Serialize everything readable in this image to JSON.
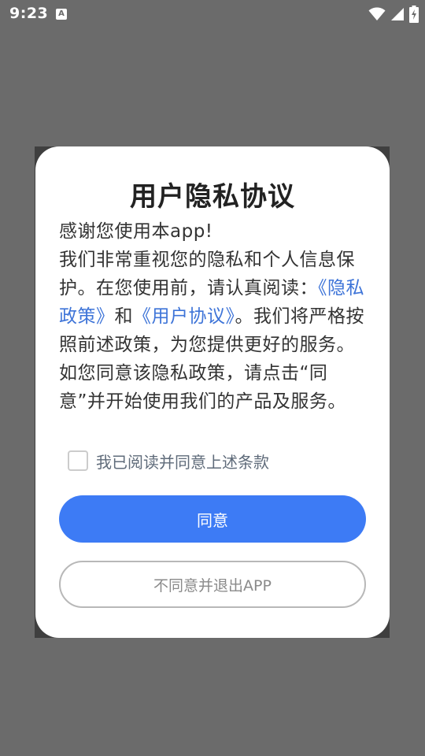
{
  "status_bar": {
    "time": "9:23",
    "notification_icon_letter": "A"
  },
  "dialog": {
    "title": "用户隐私协议",
    "body": {
      "line_intro": "感谢您使用本app!",
      "text_1": "我们非常重视您的隐私和个人信息保护。在您使用前，请认真阅读：",
      "link_privacy": "《隐私政策》",
      "text_and": "和",
      "link_user": "《用户协议》",
      "text_2": "。我们将严格按照前述政策，为您提供更好的服务。如您同意该隐私政策，请点击“同意”并开始使用我们的产品及服务。"
    },
    "checkbox_label": "我已阅读并同意上述条款",
    "agree_label": "同意",
    "disagree_label": "不同意并退出APP"
  },
  "colors": {
    "overlay": "#6b6b6b",
    "primary": "#3d7bf5",
    "link": "#3e74d8"
  }
}
